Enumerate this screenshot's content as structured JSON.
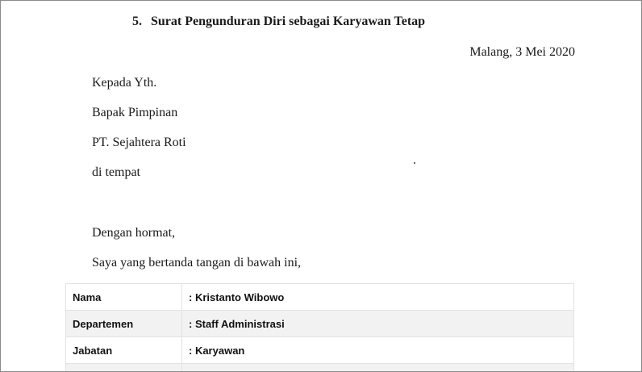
{
  "heading": {
    "number": "5.",
    "title": "Surat Pengunduran Diri sebagai Karyawan Tetap"
  },
  "date_line": "Malang, 3 Mei 2020",
  "recipient": [
    "Kepada Yth.",
    "Bapak Pimpinan",
    "PT. Sejahtera Roti",
    "di tempat"
  ],
  "greeting": "Dengan hormat,",
  "intro": "Saya yang bertanda tangan di bawah ini,",
  "identity_table": [
    {
      "label": "Nama",
      "value": ": Kristanto Wibowo"
    },
    {
      "label": "Departemen",
      "value": ": Staff Administrasi"
    },
    {
      "label": "Jabatan",
      "value": ": Karyawan"
    },
    {
      "label": "",
      "value": ""
    }
  ]
}
